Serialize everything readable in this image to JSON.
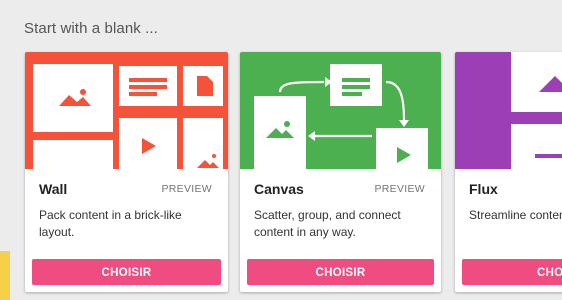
{
  "section": {
    "title": "Start with a blank ..."
  },
  "colors": {
    "wall": "#f4533a",
    "canvas": "#4caf50",
    "flux": "#9c3fb6",
    "button": "#ef4c82"
  },
  "cards": [
    {
      "name": "Wall",
      "badge": "PREVIEW",
      "description": "Pack content in a brick-like\nlayout.",
      "button": "CHOISIR"
    },
    {
      "name": "Canvas",
      "badge": "PREVIEW",
      "description": "Scatter, group, and connect\ncontent in any way.",
      "button": "CHOISIR"
    },
    {
      "name": "Flux",
      "badge": "",
      "description": "Streamline content\nread, top-to-bottom.",
      "button": "CHOISIR"
    }
  ]
}
